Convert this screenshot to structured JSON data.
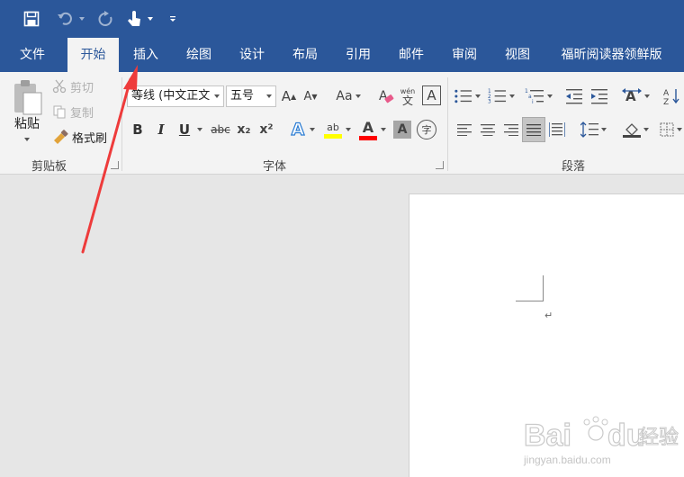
{
  "tabs": [
    "文件",
    "开始",
    "插入",
    "绘图",
    "设计",
    "布局",
    "引用",
    "邮件",
    "审阅",
    "视图",
    "福昕阅读器领鲜版"
  ],
  "active_tab": "开始",
  "clipboard": {
    "paste_label": "粘贴",
    "cut_label": "剪切",
    "copy_label": "复制",
    "format_painter_label": "格式刷",
    "group_label": "剪贴板"
  },
  "font": {
    "font_name": "等线 (中文正文",
    "font_size": "五号",
    "group_label": "字体",
    "change_case_label": "Aa",
    "bold": "B",
    "italic": "I",
    "underline": "U",
    "strikethrough": "abc",
    "subscript": "x₂",
    "superscript": "x²",
    "phonetic_top": "wén",
    "phonetic_bottom": "文",
    "char_border": "A",
    "grow": "A",
    "shrink": "A",
    "text_effect": "A",
    "highlight": "ab",
    "font_color": "A",
    "shading": "A",
    "enclose": "字"
  },
  "paragraph": {
    "group_label": "段落",
    "sort_label": "A↓"
  },
  "colors": {
    "brand": "#2b579a",
    "ribbon_bg": "#f3f3f3",
    "doc_area": "#e6e6e6",
    "highlight_yellow": "#ffff00",
    "font_red": "#ff0000",
    "annotation_red": "#ee3b3b"
  },
  "document": {
    "paragraph_mark": "↵"
  },
  "watermark": {
    "brand_a": "Bai",
    "brand_b": "du",
    "brand_cn": "经验",
    "url": "jingyan.baidu.com"
  }
}
